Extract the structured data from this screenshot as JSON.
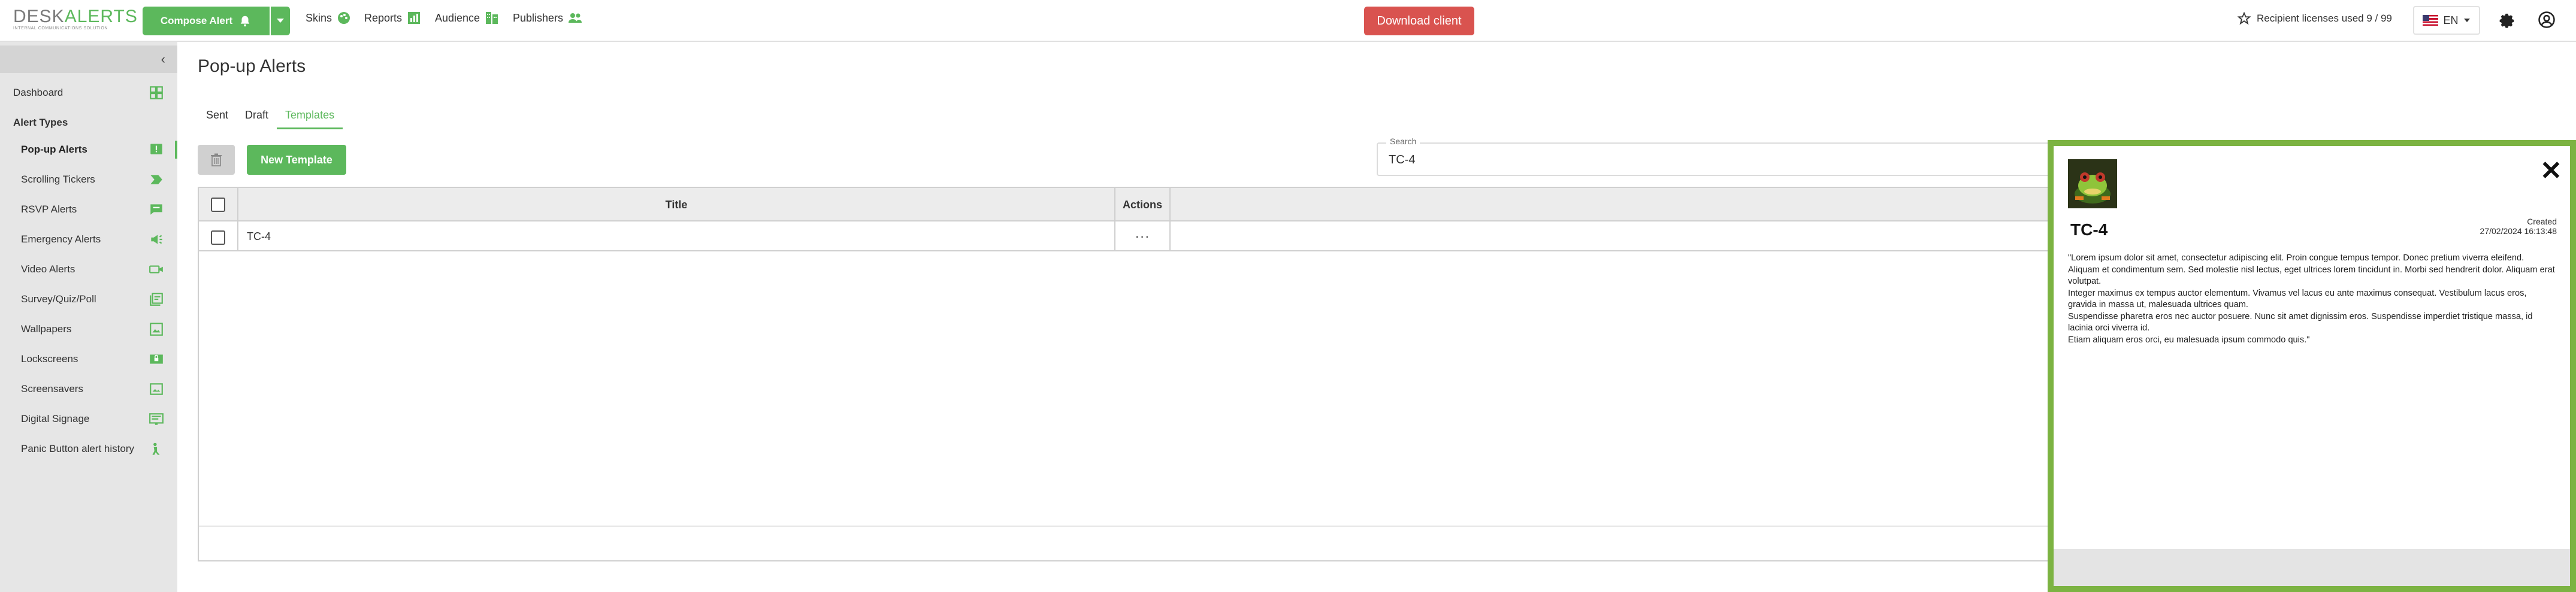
{
  "app": {
    "logo_text_a": "DESK",
    "logo_text_b": "ALERTS",
    "logo_tagline": "INTERNAL COMMUNICATIONS SOLUTION"
  },
  "topbar": {
    "compose_label": "Compose Alert",
    "nav": [
      {
        "label": "Skins",
        "icon": "palette-icon"
      },
      {
        "label": "Reports",
        "icon": "chart-icon"
      },
      {
        "label": "Audience",
        "icon": "org-chart-icon"
      },
      {
        "label": "Publishers",
        "icon": "people-icon"
      }
    ],
    "download_label": "Download client",
    "licenses_label": "Recipient licenses used 9 / 99",
    "language": "EN"
  },
  "sidebar": {
    "dashboard": "Dashboard",
    "section_title": "Alert Types",
    "items": [
      {
        "label": "Pop-up Alerts",
        "icon": "popup-icon",
        "active": true
      },
      {
        "label": "Scrolling Tickers",
        "icon": "ticker-icon"
      },
      {
        "label": "RSVP Alerts",
        "icon": "rsvp-icon"
      },
      {
        "label": "Emergency Alerts",
        "icon": "emergency-icon"
      },
      {
        "label": "Video Alerts",
        "icon": "video-icon"
      },
      {
        "label": "Survey/Quiz/Poll",
        "icon": "survey-icon"
      },
      {
        "label": "Wallpapers",
        "icon": "wallpaper-icon"
      },
      {
        "label": "Lockscreens",
        "icon": "lockscreen-icon"
      },
      {
        "label": "Screensavers",
        "icon": "screensaver-icon"
      },
      {
        "label": "Digital Signage",
        "icon": "signage-icon"
      },
      {
        "label": "Panic Button alert history",
        "icon": "panic-button-icon"
      }
    ]
  },
  "main": {
    "title": "Pop-up Alerts",
    "tabs": [
      "Sent",
      "Draft",
      "Templates"
    ],
    "active_tab": "Templates",
    "new_template_label": "New Template",
    "search": {
      "label": "Search",
      "value": "TC-4"
    },
    "table": {
      "columns": [
        "Title",
        "Actions"
      ],
      "rows": [
        {
          "title": "TC-4",
          "actions": "···"
        }
      ]
    }
  },
  "preview": {
    "title": "TC-4",
    "created_label": "Created",
    "created_value": "27/02/2024 16:13:48",
    "body": [
      "\"Lorem ipsum dolor sit amet, consectetur adipiscing elit. Proin congue tempus tempor. Donec pretium viverra eleifend.",
      "Aliquam et condimentum sem. Sed molestie nisl lectus, eget ultrices lorem tincidunt in. Morbi sed hendrerit dolor. Aliquam erat volutpat.",
      "Integer maximus ex tempus auctor elementum. Vivamus vel lacus eu ante maximus consequat. Vestibulum lacus eros, gravida in massa ut, malesuada ultrices quam.",
      "Suspendisse pharetra eros nec auctor posuere. Nunc sit amet dignissim eros. Suspendisse imperdiet tristique massa, id lacinia orci viverra id.",
      "Etiam aliquam eros orci, eu malesuada ipsum commodo quis.\""
    ]
  },
  "colors": {
    "brand_green": "#5cb85c",
    "danger_red": "#d9534f",
    "preview_border": "#7cb342"
  }
}
